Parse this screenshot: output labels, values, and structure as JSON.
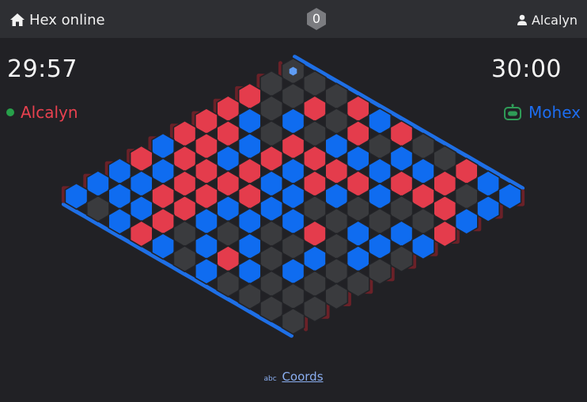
{
  "header": {
    "app_title": "Hex online",
    "move_count": "0",
    "username": "Alcalyn"
  },
  "players": {
    "left": {
      "name": "Alcalyn",
      "timer": "29:57",
      "color": "#e8414f",
      "online_color": "#27a04a",
      "icon": "dot-icon"
    },
    "right": {
      "name": "Mohex",
      "timer": "30:00",
      "color": "#1d6df0",
      "icon": "robot-icon"
    }
  },
  "board": {
    "size": 11,
    "colors": {
      "red": "#e43c4c",
      "blue": "#0f6cf0",
      "empty": "#3a3b3e",
      "red_edge": "#6b2128",
      "blue_edge": "#1e6fe6",
      "last_move": "#5f9df5"
    },
    "rows": [
      "...rbr..rbb",
      "..r.r.bbr.b",
      "r.b.bbbrrrb",
      "rb.rrrrb..r",
      "rrbrbrb..bb",
      "rrbrbb..bb.",
      "brrrrbbr.b.",
      "rbrrbb..b..",
      "bbrrb.b.b..",
      "bbbr.brb...",
      "b.brb.b...."
    ],
    "last_move": [
      0,
      0
    ]
  },
  "footer": {
    "coords_prefix": "abc",
    "coords_label": "Coords"
  }
}
